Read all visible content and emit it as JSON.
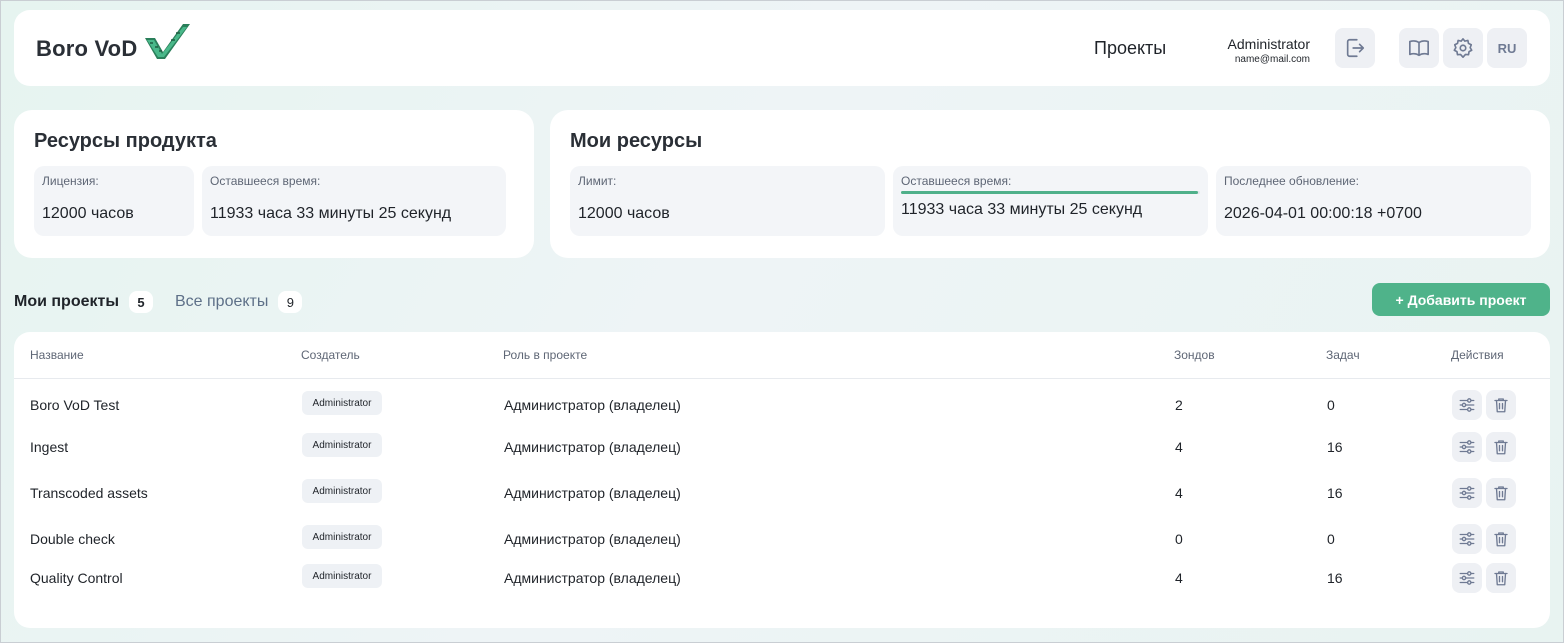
{
  "header": {
    "logo_text": "Boro VoD",
    "nav_projects": "Проекты",
    "user_name": "Administrator",
    "user_email": "name@mail.com",
    "lang": "RU",
    "icons": [
      "logout-icon",
      "book-icon",
      "gear-icon"
    ]
  },
  "product_resources": {
    "title": "Ресурсы продукта",
    "license_label": "Лицензия:",
    "license_value": "12000 часов",
    "remaining_label": "Оставшееся время:",
    "remaining_value": "11933 часа 33 минуты 25 секунд"
  },
  "my_resources": {
    "title": "Мои ресурсы",
    "limit_label": "Лимит:",
    "limit_value": "12000 часов",
    "remaining_label": "Оставшееся время:",
    "remaining_value": "11933 часа 33 минуты 25 секунд",
    "remaining_fraction": 0.9944,
    "updated_label": "Последнее обновление:",
    "updated_value": "2026-04-01 00:00:18 +0700"
  },
  "tabs": [
    {
      "label": "Мои проекты",
      "count": "5",
      "active": true
    },
    {
      "label": "Все проекты",
      "count": "9",
      "active": false
    }
  ],
  "add_project_label": "+ Добавить проект",
  "table": {
    "columns": [
      "Название",
      "Создатель",
      "Роль в проекте",
      "Зондов",
      "Задач",
      "Действия"
    ],
    "rows": [
      {
        "name": "Boro VoD Test",
        "creator": "Administrator",
        "role": "Администратор (владелец)",
        "probes": "2",
        "tasks": "0"
      },
      {
        "name": "Ingest",
        "creator": "Administrator",
        "role": "Администратор (владелец)",
        "probes": "4",
        "tasks": "16"
      },
      {
        "name": "Transcoded assets",
        "creator": "Administrator",
        "role": "Администратор (владелец)",
        "probes": "4",
        "tasks": "16"
      },
      {
        "name": "Double check",
        "creator": "Administrator",
        "role": "Администратор (владелец)",
        "probes": "0",
        "tasks": "0"
      },
      {
        "name": "Quality Control",
        "creator": "Administrator",
        "role": "Администратор (владелец)",
        "probes": "4",
        "tasks": "16"
      }
    ]
  },
  "colors": {
    "accent": "#4fb38a",
    "icon": "#6f7a93"
  }
}
